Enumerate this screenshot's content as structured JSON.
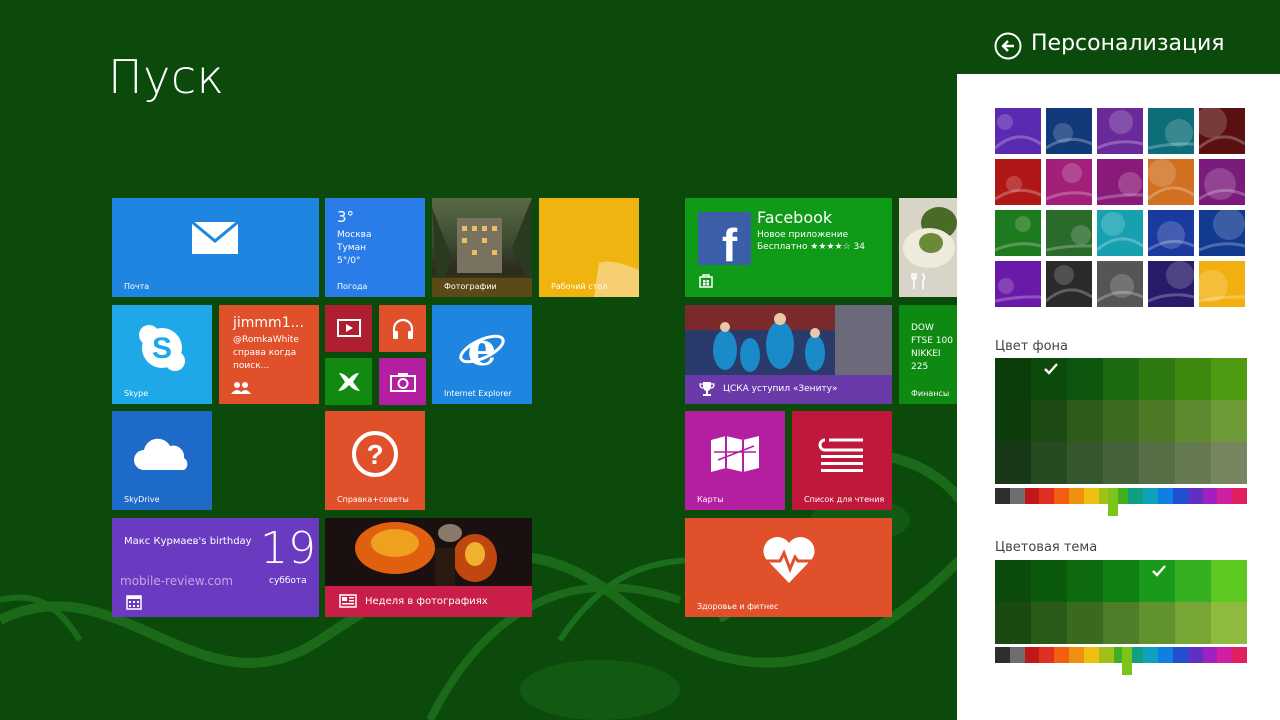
{
  "start": {
    "title": "Пуск"
  },
  "tiles": {
    "mail": {
      "label": "Почта"
    },
    "weather": {
      "temp": "3°",
      "city": "Москва",
      "cond": "Туман",
      "range": "5°/0°",
      "label": "Погода"
    },
    "photos": {
      "label": "Фотографии"
    },
    "desktop": {
      "label": "Рабочий стол"
    },
    "facebook": {
      "title": "Facebook",
      "sub1": "Новое приложение",
      "sub2": "Бесплатно ★★★★☆ 34"
    },
    "skype": {
      "label": "Skype"
    },
    "people": {
      "name": "jimmm1...",
      "handle": "@RomkaWhite",
      "msg1": "справа когда",
      "msg2": "поиск..."
    },
    "ie": {
      "label": "Internet Explorer"
    },
    "sport": {
      "label": "ЦСКА уступил «Зениту»"
    },
    "finance": {
      "l1": "DOW",
      "l2": "FTSE 100",
      "l3": "NIKKEI 225",
      "label": "Финансы"
    },
    "skydrive": {
      "label": "SkyDrive"
    },
    "help": {
      "label": "Справка+советы"
    },
    "maps": {
      "label": "Карты"
    },
    "reading": {
      "label": "Список для чтения"
    },
    "calendar": {
      "event": "Макс Курмаев's birthday",
      "day": "19",
      "weekday": "суббота"
    },
    "news": {
      "label": "Неделя в фотографиях"
    },
    "health": {
      "label": "Здоровье и фитнес"
    }
  },
  "watermark": "mobile-review.com",
  "panel": {
    "title": "Персонализация",
    "bg_label": "Цвет фона",
    "theme_label": "Цветовая тема",
    "patterns": [
      "#5a2ab0",
      "#123a7a",
      "#6a2a9a",
      "#0d6e7a",
      "#5a1010",
      "#b01818",
      "#a0207a",
      "#8a1a7a",
      "#d07020",
      "#7a1a7a",
      "#1e7a1e",
      "#2a6a2a",
      "#17a0b0",
      "#1a3aa0",
      "#123a90",
      "#6a1aa8",
      "#2a2a2a",
      "#555555",
      "#2a1a6a",
      "#f2b010"
    ],
    "bg_grid": [
      [
        "#0a3d0a",
        "#0b4a0b",
        "#0e560e",
        "#1e6a10",
        "#2e7a10",
        "#3e8a10",
        "#4e9a10"
      ],
      [
        "#0d3d0d",
        "#1e4a14",
        "#2e5a1a",
        "#3e6a22",
        "#4e7a28",
        "#5e8a30",
        "#6e9a38"
      ],
      [
        "#183818",
        "#264a22",
        "#36562e",
        "#46623a",
        "#566e46",
        "#667a52",
        "#76865e"
      ]
    ],
    "theme_grid": [
      [
        "#0a4a0a",
        "#0b5a0b",
        "#0e6a0e",
        "#108010",
        "#1a9a1a",
        "#36b020",
        "#5cc820"
      ],
      [
        "#1a4a10",
        "#2a5a18",
        "#3a6a20",
        "#4e7e28",
        "#62922e",
        "#78a636",
        "#8eba3e"
      ]
    ],
    "hues": [
      "#2e2e2e",
      "#6e6e6e",
      "#c01818",
      "#e03020",
      "#f06010",
      "#f09010",
      "#f0c010",
      "#a0c018",
      "#40b020",
      "#10a080",
      "#10a0c0",
      "#1080e0",
      "#2050d0",
      "#6030c0",
      "#a020c0",
      "#d020a0",
      "#e02060"
    ]
  }
}
